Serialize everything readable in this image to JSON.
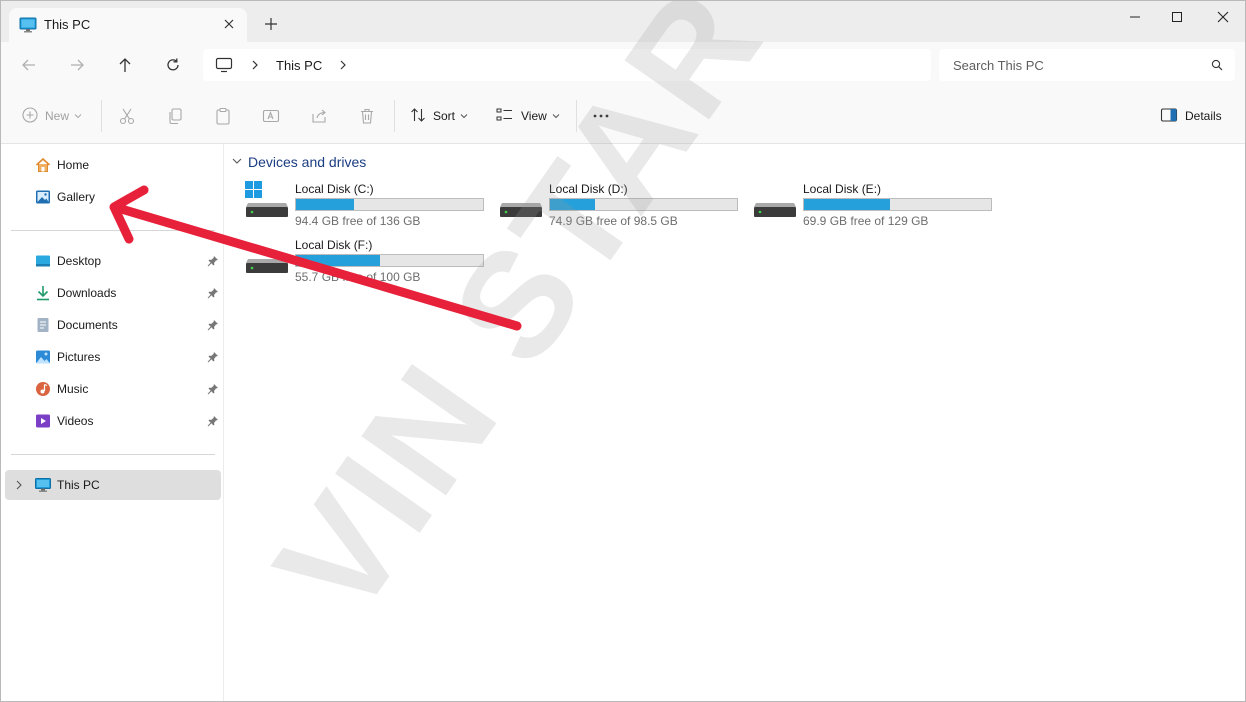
{
  "window": {
    "tab_title": "This PC"
  },
  "nav": {
    "address_crumb": "This PC",
    "search_placeholder": "Search This PC"
  },
  "commands": {
    "new": "New",
    "sort": "Sort",
    "view": "View",
    "details": "Details"
  },
  "sidebar": {
    "quick": [
      {
        "label": "Home",
        "icon": "home-icon"
      },
      {
        "label": "Gallery",
        "icon": "gallery-icon"
      }
    ],
    "pinned": [
      {
        "label": "Desktop",
        "icon": "desktop-icon"
      },
      {
        "label": "Downloads",
        "icon": "downloads-icon"
      },
      {
        "label": "Documents",
        "icon": "documents-icon"
      },
      {
        "label": "Pictures",
        "icon": "pictures-icon"
      },
      {
        "label": "Music",
        "icon": "music-icon"
      },
      {
        "label": "Videos",
        "icon": "videos-icon"
      }
    ],
    "this_pc": {
      "label": "This PC",
      "icon": "computer-icon"
    }
  },
  "content": {
    "group_title": "Devices and drives",
    "drives": [
      {
        "name": "Local Disk (C:)",
        "free": "94.4 GB free of 136 GB",
        "used_fraction": 0.31,
        "system": true
      },
      {
        "name": "Local Disk (D:)",
        "free": "74.9 GB free of 98.5 GB",
        "used_fraction": 0.24,
        "system": false
      },
      {
        "name": "Local Disk (E:)",
        "free": "69.9 GB free of 129 GB",
        "used_fraction": 0.46,
        "system": false
      },
      {
        "name": "Local Disk (F:)",
        "free": "55.7 GB free of 100 GB",
        "used_fraction": 0.45,
        "system": false
      }
    ]
  },
  "overlay": {
    "watermark_text": "VIN STAR",
    "arrow_color": "#e8213a"
  },
  "colors": {
    "accent": "#26a0da",
    "group_header": "#1b3d82",
    "selected_bg": "#dedede"
  }
}
